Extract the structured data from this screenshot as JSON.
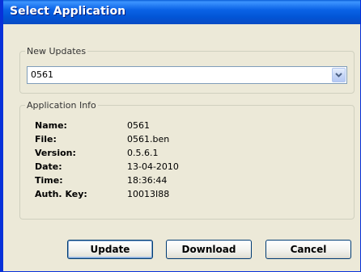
{
  "window": {
    "title": "Select Application"
  },
  "new_updates": {
    "legend": "New Updates",
    "selected": "0561"
  },
  "app_info": {
    "legend": "Application Info",
    "rows": [
      {
        "label": "Name:",
        "value": "0561"
      },
      {
        "label": "File:",
        "value": "0561.ben"
      },
      {
        "label": "Version:",
        "value": "0.5.6.1"
      },
      {
        "label": "Date:",
        "value": "13-04-2010"
      },
      {
        "label": "Time:",
        "value": "18:36:44"
      },
      {
        "label": "Auth. Key:",
        "value": "10013I88"
      }
    ]
  },
  "buttons": {
    "update": "Update",
    "download": "Download",
    "cancel": "Cancel"
  },
  "colors": {
    "titlebar": "#0A5FD8",
    "dialog_bg": "#ECE9D8",
    "button_border": "#003C74"
  },
  "icons": {
    "dropdown": "chevron-down-icon"
  }
}
